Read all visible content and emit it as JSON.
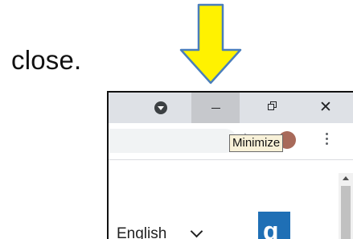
{
  "caption": {
    "text": "close."
  },
  "annotation": {
    "arrow_color": "#FFF200",
    "arrow_outline": "#4A7EBB"
  },
  "window_controls": {
    "minimize_icon": "minimize-icon",
    "restore_icon": "restore-icon",
    "close_icon": "close-icon",
    "close_glyph": "✕",
    "hovered": "minimize"
  },
  "toolbar": {
    "star_icon": "bookmark-star-icon",
    "star_glyph": "☆",
    "menu_icon": "kebab-menu-icon"
  },
  "tooltip": {
    "text": "Minimize"
  },
  "content": {
    "language_selector": {
      "label": "English"
    },
    "logo": {
      "glyph": "g",
      "color": "#1F6FB5"
    }
  }
}
